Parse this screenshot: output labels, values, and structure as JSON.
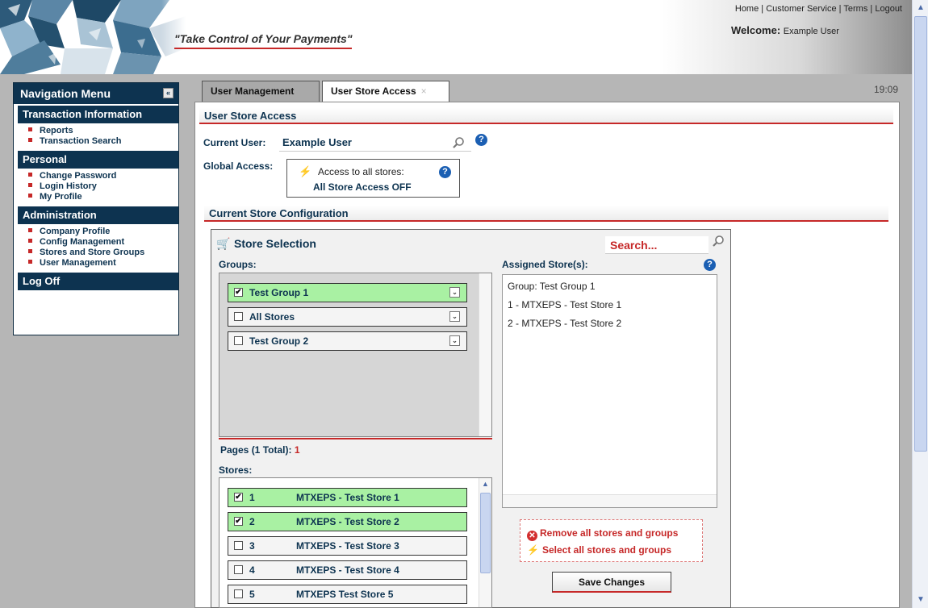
{
  "header": {
    "slogan": "\"Take Control of Your Payments\"",
    "links": [
      "Home",
      "Customer Service",
      "Terms",
      "Logout"
    ],
    "welcome_label": "Welcome:",
    "welcome_user": "Example User"
  },
  "nav": {
    "title": "Navigation Menu",
    "collapse_glyph": "«",
    "sections": [
      {
        "label": "Transaction Information",
        "items": [
          "Reports",
          "Transaction Search"
        ]
      },
      {
        "label": "Personal",
        "items": [
          "Change Password",
          "Login History",
          "My Profile"
        ]
      },
      {
        "label": "Administration",
        "items": [
          "Company Profile",
          "Config Management",
          "Stores and Store Groups",
          "User Management"
        ]
      },
      {
        "label": "Log Off",
        "items": []
      }
    ]
  },
  "tabs": [
    {
      "label": "User Management",
      "active": false
    },
    {
      "label": "User Store Access",
      "active": true,
      "close": "×"
    }
  ],
  "clock": "19:09",
  "user_store_access": {
    "section_title": "User Store Access",
    "current_user_label": "Current User:",
    "current_user_value": "Example User",
    "global_access_label": "Global Access:",
    "global_access_line1": "Access to all stores:",
    "global_access_line2": "All Store Access OFF"
  },
  "config": {
    "section_title": "Current Store Configuration",
    "store_selection_title": "Store Selection",
    "search_placeholder": "Search...",
    "groups_label": "Groups:",
    "groups": [
      {
        "label": "Test Group 1",
        "checked": true
      },
      {
        "label": "All Stores",
        "checked": false
      },
      {
        "label": "Test Group 2",
        "checked": false
      }
    ],
    "pages_label": "Pages (1 Total):",
    "pages_value": "1",
    "stores_label": "Stores:",
    "stores": [
      {
        "num": "1",
        "name": "MTXEPS - Test Store 1",
        "checked": true
      },
      {
        "num": "2",
        "name": "MTXEPS - Test Store 2",
        "checked": true
      },
      {
        "num": "3",
        "name": "MTXEPS - Test Store 3",
        "checked": false
      },
      {
        "num": "4",
        "name": "MTXEPS - Test Store 4",
        "checked": false
      },
      {
        "num": "5",
        "name": "MTXEPS Test Store 5",
        "checked": false
      }
    ],
    "assigned_label": "Assigned Store(s):",
    "assigned": [
      "Group: Test Group 1",
      "1 - MTXEPS - Test Store 1",
      "2 - MTXEPS - Test Store 2"
    ],
    "remove_all": "Remove all stores and groups",
    "select_all": "Select all stores and groups",
    "save_button": "Save Changes"
  },
  "colors": {
    "navy": "#0d3350",
    "accent_red": "#c62828",
    "selected_green": "#a9f1a3"
  }
}
